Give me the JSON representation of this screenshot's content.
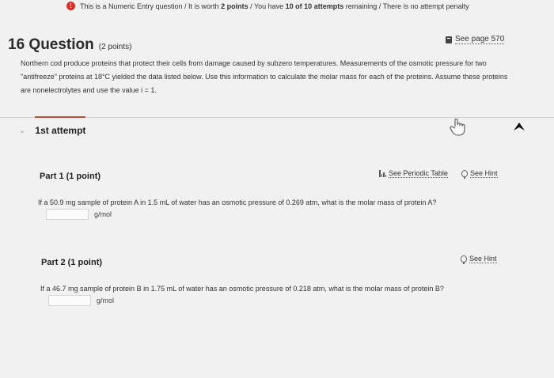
{
  "banner": {
    "info_glyph": "!",
    "prefix": "This is a Numeric Entry question / It is worth",
    "points": "2 points",
    "mid": "/ You have",
    "attempts": "10 of 10 attempts",
    "suffix": "remaining / There is no attempt penalty"
  },
  "question": {
    "title": "16 Question",
    "points": "(2 points)",
    "see_page": "See page 570",
    "text": "Northern cod produce proteins that protect their cells from damage caused by subzero temperatures. Measurements of the osmotic pressure for two \"antifreeze\" proteins at 18°C yielded the data listed below. Use this information to calculate the molar mass for each of the proteins. Assume these proteins are nonelectrolytes and use the value i = 1."
  },
  "attempt": {
    "chevron": "⌄",
    "label": "1st attempt"
  },
  "part1": {
    "title": "Part 1",
    "points": "(1 point)",
    "periodic_table": "See Periodic Table",
    "hint": "See Hint",
    "text": "If a 50.9 mg sample of protein A in 1.5 mL of water has an osmotic pressure of 0.269 atm, what is the molar mass of protein A?",
    "answer_value": "",
    "unit": "g/mol"
  },
  "part2": {
    "title": "Part 2",
    "points": "(1 point)",
    "hint": "See Hint",
    "text": "If a 46.7 mg sample of protein B in 1.75 mL of water has an osmotic pressure of 0.218 atm, what is the molar mass of protein B?",
    "answer_value": "",
    "unit": "g/mol"
  },
  "colors": {
    "accent": "#c84a3a",
    "info": "#d9302b",
    "background": "#f1f1f1"
  }
}
